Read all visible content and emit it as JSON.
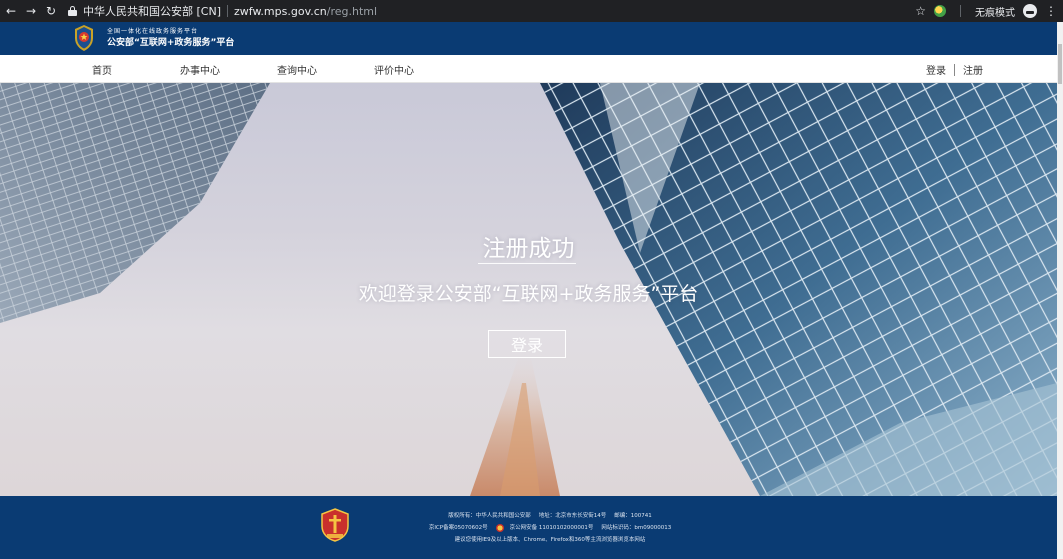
{
  "browser": {
    "cert_label": "中华人民共和国公安部 [CN]",
    "url_host": "zwfw.mps.gov.cn",
    "url_path": "/reg.html",
    "incognito_label": "无痕模式"
  },
  "header": {
    "small_text": "全国一体化在线政务服务平台",
    "title": "公安部“互联网+政务服务”平台"
  },
  "nav": {
    "items": [
      "首页",
      "办事中心",
      "查询中心",
      "评价中心"
    ],
    "login": "登录",
    "register": "注册"
  },
  "hero": {
    "title": "注册成功",
    "subtitle": "欢迎登录公安部“互联网+政务服务”平台",
    "login_button": "登录"
  },
  "footer": {
    "line1_a": "版权所有：中华人民共和国公安部",
    "line1_b": "地址：北京市东长安街14号",
    "line1_c": "邮编：100741",
    "line2_a": "京ICP备案05070602号",
    "line2_b": "京公网安备 11010102000001号",
    "line2_c": "网站标识码：bm09000013",
    "line3": "建议您使用IE9及以上版本、Chrome、Firefox和360等主流浏览器浏览本网站"
  },
  "colors": {
    "brand_blue": "#0a3b73",
    "chrome_dark": "#202124"
  }
}
